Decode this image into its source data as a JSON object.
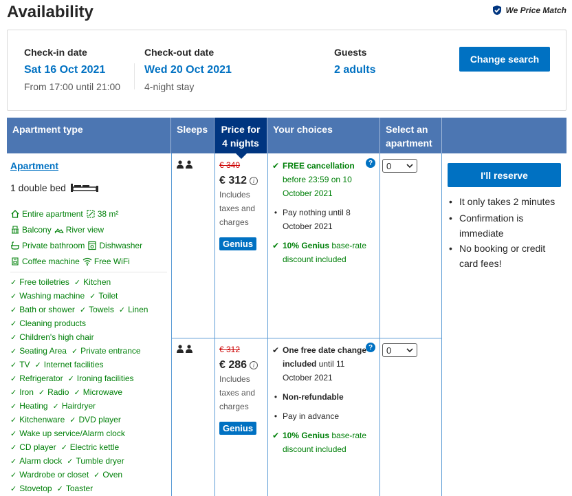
{
  "page": {
    "title": "Availability",
    "price_match": "We Price Match"
  },
  "search": {
    "checkin_label": "Check-in date",
    "checkin_value": "Sat 16 Oct 2021",
    "checkin_sub": "From 17:00 until 21:00",
    "checkout_label": "Check-out date",
    "checkout_value": "Wed 20 Oct 2021",
    "checkout_sub": "4-night stay",
    "guests_label": "Guests",
    "guests_value": "2 adults",
    "change_button": "Change search"
  },
  "table": {
    "headers": {
      "apartment_type": "Apartment type",
      "sleeps": "Sleeps",
      "price_line1": "Price for",
      "price_line2": "4 nights",
      "choices": "Your choices",
      "select_line1": "Select an",
      "select_line2": "apartment"
    },
    "apartment": {
      "name": "Apartment",
      "bed": "1 double bed",
      "facilities": [
        [
          {
            "icon": "house-icon",
            "label": "Entire apartment"
          },
          {
            "icon": "size-icon",
            "label": "38 m²"
          }
        ],
        [
          {
            "icon": "balcony-icon",
            "label": "Balcony"
          },
          {
            "icon": "river-view-icon",
            "label": "River view"
          }
        ],
        [
          {
            "icon": "bath-icon",
            "label": "Private bathroom"
          },
          {
            "icon": "dishwasher-icon",
            "label": "Dishwasher"
          }
        ],
        [
          {
            "icon": "coffee-machine-icon",
            "label": "Coffee machine"
          },
          {
            "icon": "wifi-icon",
            "label": "Free WiFi"
          }
        ]
      ],
      "amenities": [
        [
          "Free toiletries",
          "Kitchen"
        ],
        [
          "Washing machine",
          "Toilet"
        ],
        [
          "Bath or shower",
          "Towels",
          "Linen"
        ],
        [
          "Cleaning products"
        ],
        [
          "Children's high chair"
        ],
        [
          "Seating Area",
          "Private entrance"
        ],
        [
          "TV",
          "Internet facilities"
        ],
        [
          "Refrigerator",
          "Ironing facilities"
        ],
        [
          "Iron",
          "Radio",
          "Microwave"
        ],
        [
          "Heating",
          "Hairdryer"
        ],
        [
          "Kitchenware",
          "DVD player"
        ],
        [
          "Wake up service/Alarm clock"
        ],
        [
          "CD player",
          "Electric kettle"
        ],
        [
          "Alarm clock",
          "Tumble dryer"
        ],
        [
          "Wardrobe or closet",
          "Oven"
        ],
        [
          "Stovetop",
          "Toaster"
        ]
      ]
    },
    "rates": [
      {
        "old_price": "€ 340",
        "new_price": "€ 312",
        "note": "Includes taxes and charges",
        "badge": "Genius",
        "choices": [
          {
            "mark": "check",
            "green": true,
            "bold_text": "FREE cancellation",
            "text": " before 23:59 on 10 October 2021"
          },
          {
            "mark": "bullet",
            "green": false,
            "bold_text": "",
            "text": "Pay nothing until 8 October 2021"
          },
          {
            "mark": "check",
            "green": true,
            "bold_text": "10% Genius",
            "text": " base-rate discount included"
          }
        ],
        "select_value": "0"
      },
      {
        "old_price": "€ 312",
        "new_price": "€ 286",
        "note": "Includes taxes and charges",
        "badge": "Genius",
        "choices": [
          {
            "mark": "check-dark",
            "green": false,
            "bold_text": "One free date change included",
            "text": " until 11 October 2021"
          },
          {
            "mark": "bullet",
            "green": false,
            "bold_text": "Non-refundable",
            "text": ""
          },
          {
            "mark": "bullet",
            "green": false,
            "bold_text": "",
            "text": "Pay in advance"
          },
          {
            "mark": "check",
            "green": true,
            "bold_text": "10% Genius",
            "text": " base-rate discount included"
          }
        ],
        "select_value": "0"
      }
    ],
    "reserve_button": "I'll reserve",
    "benefits": [
      "It only takes 2 minutes",
      "Confirmation is immediate",
      "No booking or credit card fees!"
    ]
  },
  "colors": {
    "primary": "#0071c2",
    "header": "#4c76b2",
    "header_selected": "#003580",
    "green": "#008009",
    "red": "#cc0000"
  }
}
